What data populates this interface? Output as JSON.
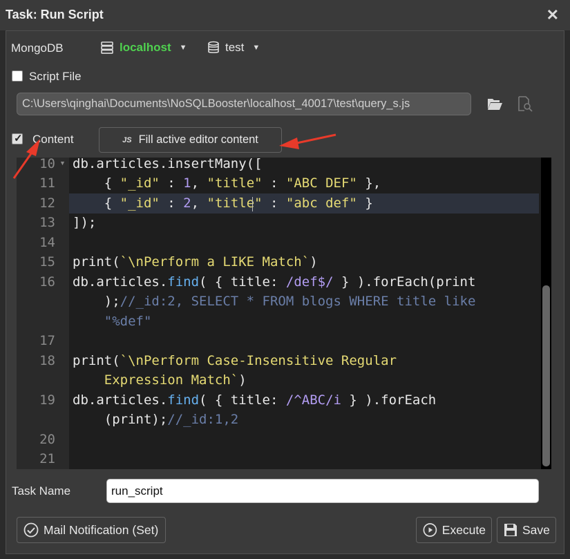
{
  "window": {
    "title": "Task: Run Script"
  },
  "connection": {
    "label": "MongoDB",
    "host": "localhost",
    "database": "test",
    "host_color": "#4fd14f"
  },
  "script_file": {
    "label": "Script File",
    "checked": false,
    "path": "C:\\Users\\qinghai\\Documents\\NoSQLBooster\\localhost_40017\\test\\query_s.js",
    "icons": [
      "folder-open-icon",
      "file-search-icon"
    ]
  },
  "content": {
    "label": "Content",
    "checked": true,
    "fill_button_label": "Fill active editor content"
  },
  "editor": {
    "line_numbers": [
      "10",
      "11",
      "12",
      "13",
      "14",
      "15",
      "16",
      "17",
      "18",
      "19",
      "20",
      "21"
    ],
    "current_line": "12"
  },
  "task_name": {
    "label": "Task Name",
    "value": "run_script"
  },
  "buttons": {
    "mail": "Mail Notification (Set)",
    "execute": "Execute",
    "save": "Save"
  }
}
